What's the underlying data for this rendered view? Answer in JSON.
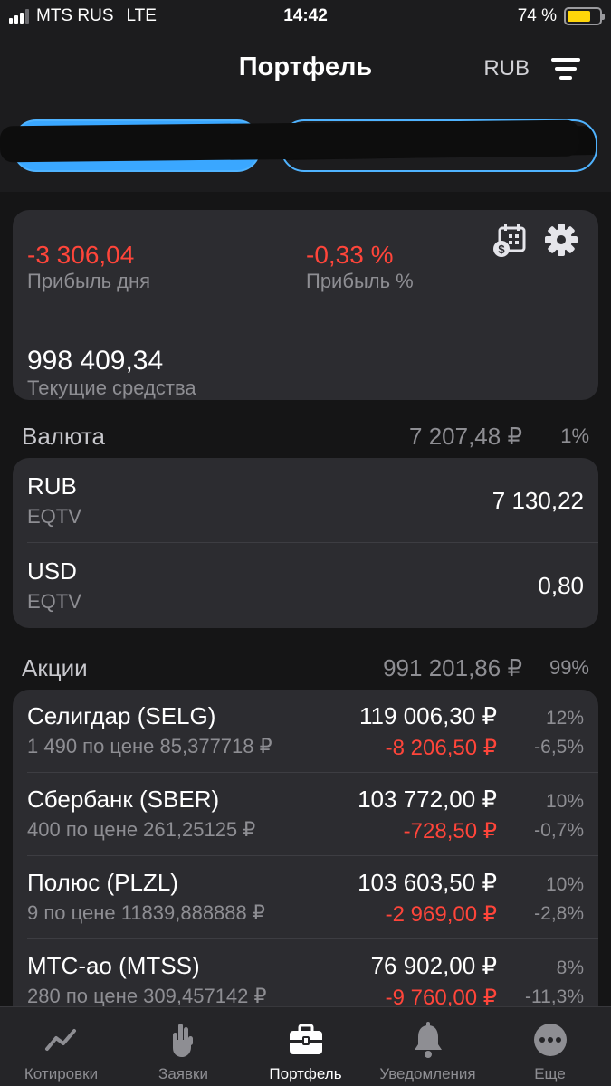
{
  "status_bar": {
    "carrier": "MTS RUS",
    "network": "LTE",
    "time": "14:42",
    "battery": "74 %",
    "battery_level": 0.74
  },
  "header": {
    "title": "Портфель",
    "currency": "RUB"
  },
  "summary": {
    "day_profit_value": "-3 306,04",
    "day_profit_label": "Прибыль дня",
    "profit_pct_value": "-0,33 %",
    "profit_pct_label": "Прибыль %",
    "current_funds_value": "998 409,34",
    "current_funds_label": "Текущие средства"
  },
  "currency_section": {
    "title": "Валюта",
    "sum": "7 207,48 ₽",
    "share": "1%",
    "items": [
      {
        "name": "RUB",
        "sub": "EQTV",
        "amount": "7 130,22"
      },
      {
        "name": "USD",
        "sub": "EQTV",
        "amount": "0,80"
      }
    ]
  },
  "stocks_section": {
    "title": "Акции",
    "sum": "991 201,86 ₽",
    "share": "99%",
    "items": [
      {
        "name": "Селигдар (SELG)",
        "sub": "1 490 по цене 85,377718 ₽",
        "price": "119 006,30 ₽",
        "change": "-8 206,50 ₽",
        "share": "12%",
        "change_pct": "-6,5%"
      },
      {
        "name": "Сбербанк (SBER)",
        "sub": "400 по цене 261,25125 ₽",
        "price": "103 772,00 ₽",
        "change": "-728,50 ₽",
        "share": "10%",
        "change_pct": "-0,7%"
      },
      {
        "name": "Полюс (PLZL)",
        "sub": "9 по цене 11839,888888 ₽",
        "price": "103 603,50 ₽",
        "change": "-2 969,00 ₽",
        "share": "10%",
        "change_pct": "-2,8%"
      },
      {
        "name": "МТС-ао (MTSS)",
        "sub": "280 по цене 309,457142 ₽",
        "price": "76 902,00 ₽",
        "change": "-9 760,00 ₽",
        "share": "8%",
        "change_pct": "-11,3%"
      }
    ]
  },
  "tabbar": {
    "items": [
      {
        "label": "Котировки",
        "icon": "chart-line-icon"
      },
      {
        "label": "Заявки",
        "icon": "hand-icon"
      },
      {
        "label": "Портфель",
        "icon": "briefcase-icon"
      },
      {
        "label": "Уведомления",
        "icon": "bell-icon"
      },
      {
        "label": "Еще",
        "icon": "more-icon"
      }
    ]
  },
  "colors": {
    "negative": "#ff453a",
    "accent": "#3aa7ff",
    "battery": "#ffd60a"
  }
}
